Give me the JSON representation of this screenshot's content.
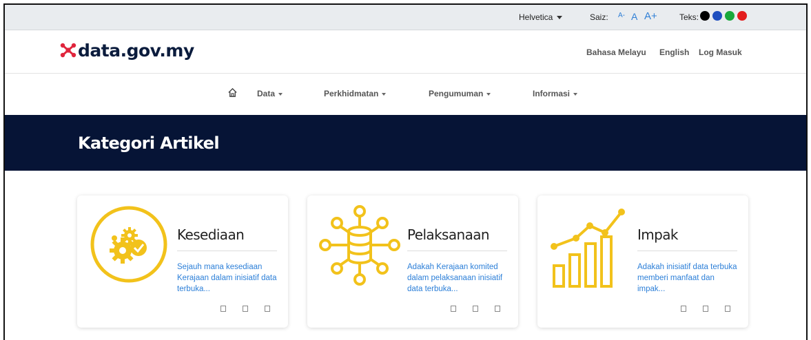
{
  "utility_bar": {
    "font_label": "Helvetica",
    "size_label": "Saiz:",
    "size_small": "A-",
    "size_normal": "A",
    "size_large": "A+",
    "text_label": "Teks:",
    "text_colors": [
      "#000000",
      "#1f4fbf",
      "#18a83a",
      "#e31d1d"
    ]
  },
  "header": {
    "logo_text": "data.gov.my",
    "links": [
      "Bahasa Melayu",
      "English",
      "Log Masuk"
    ]
  },
  "nav": {
    "items": [
      "Data",
      "Perkhidmatan",
      "Pengumuman",
      "Informasi"
    ]
  },
  "banner": {
    "title": "Kategori Artikel"
  },
  "cards": [
    {
      "title": "Kesediaan",
      "description": "Sejauh mana kesediaan Kerajaan dalam inisiatif data terbuka...",
      "icon": "gears-check-icon"
    },
    {
      "title": "Pelaksanaan",
      "description": "Adakah Kerajaan komited dalam pelaksanaan inisiatif data terbuka...",
      "icon": "database-network-icon"
    },
    {
      "title": "Impak",
      "description": "Adakah inisiatif data terbuka memberi manfaat dan impak...",
      "icon": "growth-chart-icon"
    }
  ],
  "colors": {
    "accent": "#f2c21b",
    "navy": "#061436",
    "link": "#2c7fd8"
  }
}
